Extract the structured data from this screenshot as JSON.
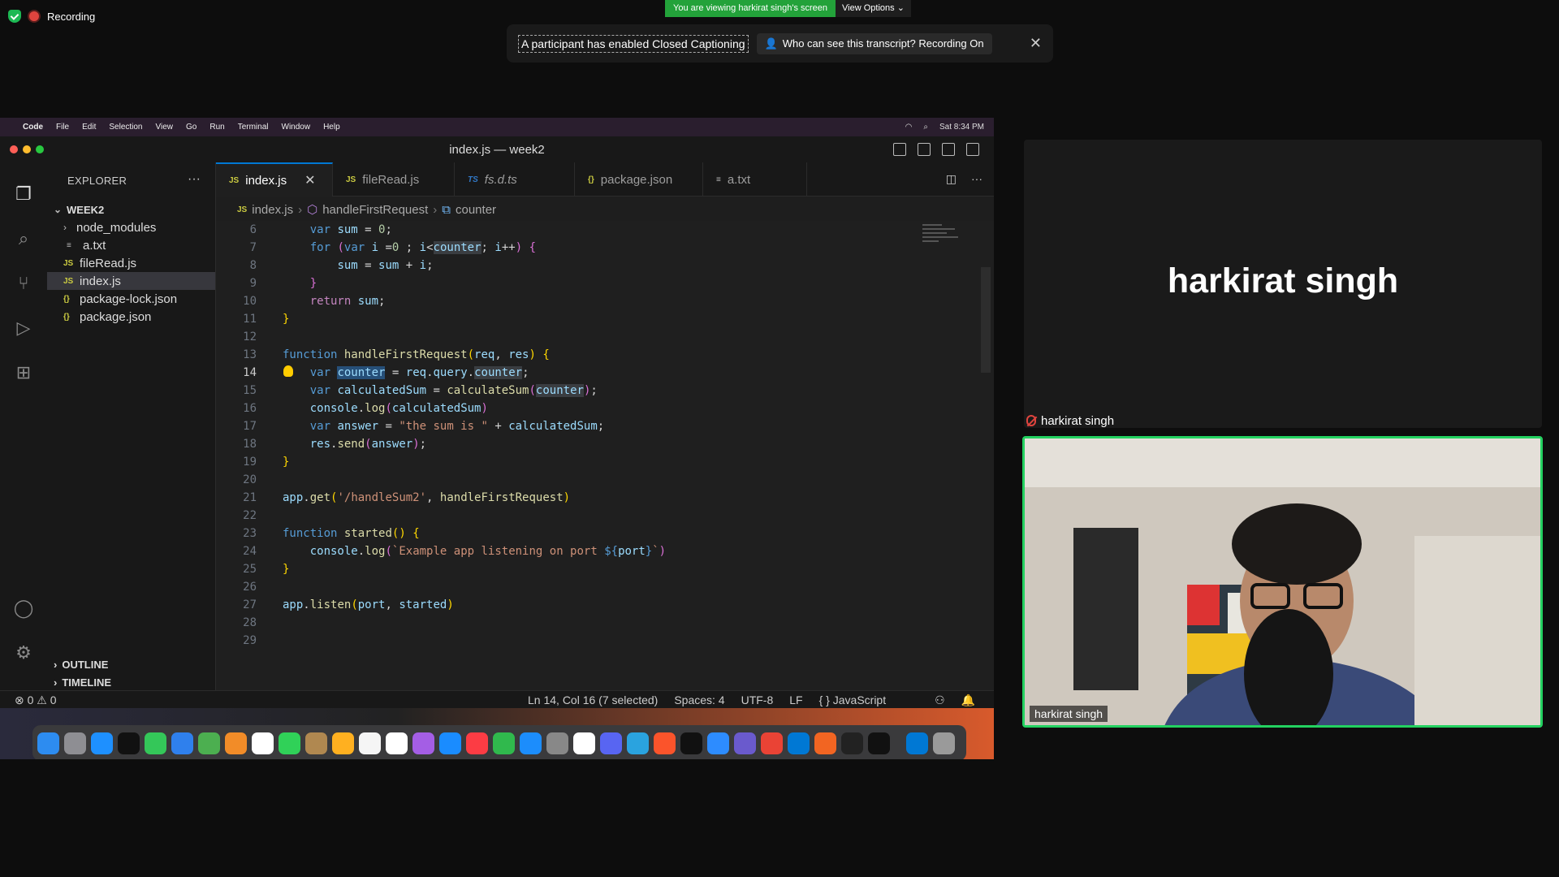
{
  "zoom": {
    "recording_label": "Recording",
    "viewing_text": "You are viewing harkirat singh's screen",
    "view_options": "View Options",
    "caption_notice": "A participant has enabled Closed Captioning",
    "transcript_button": "Who can see this transcript? Recording On",
    "speaker_name": "harkirat singh",
    "participant_label": "harkirat singh",
    "video_name": "harkirat singh",
    "colors": {
      "green": "#23a23a",
      "active_border": "#23d160",
      "rec": "#e0443e"
    }
  },
  "mac": {
    "menus": [
      "Code",
      "File",
      "Edit",
      "Selection",
      "View",
      "Go",
      "Run",
      "Terminal",
      "Window",
      "Help"
    ],
    "clock": "Sat 8:34 PM"
  },
  "vscode": {
    "window_title": "index.js — week2",
    "explorer_title": "EXPLORER",
    "folder": "WEEK2",
    "tree": [
      {
        "label": "node_modules",
        "icon": "folder-icon"
      },
      {
        "label": "a.txt",
        "icon": "txt-icon"
      },
      {
        "label": "fileRead.js",
        "icon": "JS"
      },
      {
        "label": "index.js",
        "icon": "JS"
      },
      {
        "label": "package-lock.json",
        "icon": "{}"
      },
      {
        "label": "package.json",
        "icon": "{}"
      }
    ],
    "outline": "OUTLINE",
    "timeline": "TIMELINE",
    "tabs": [
      {
        "label": "index.js",
        "icon": "JS"
      },
      {
        "label": "fileRead.js",
        "icon": "JS"
      },
      {
        "label": "fs.d.ts",
        "icon": "TS"
      },
      {
        "label": "package.json",
        "icon": "{}"
      },
      {
        "label": "a.txt",
        "icon": "≡"
      }
    ],
    "breadcrumb": [
      "index.js",
      "handleFirstRequest",
      "counter"
    ],
    "line_numbers": [
      "6",
      "7",
      "8",
      "9",
      "10",
      "11",
      "12",
      "13",
      "14",
      "15",
      "16",
      "17",
      "18",
      "19",
      "20",
      "21",
      "22",
      "23",
      "24",
      "25",
      "26",
      "27",
      "28",
      "29"
    ],
    "status": {
      "problems": "⊗ 0 ⚠ 0",
      "position": "Ln 14, Col 16 (7 selected)",
      "spaces": "Spaces: 4",
      "encoding": "UTF-8",
      "eol": "LF",
      "language": "{ } JavaScript"
    }
  }
}
